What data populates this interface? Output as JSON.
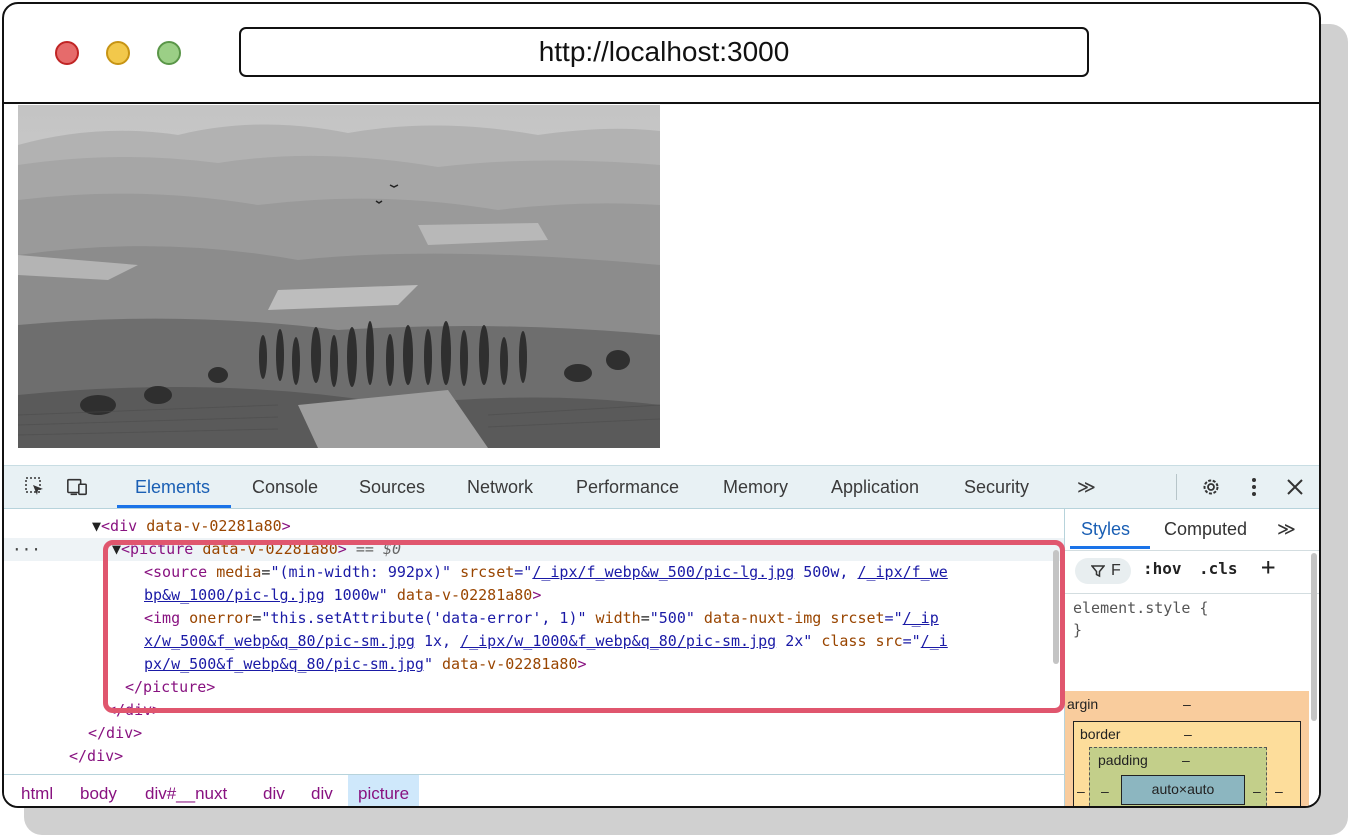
{
  "browser": {
    "url": "http://localhost:3000",
    "traffic_lights": {
      "close": "#e66b6b",
      "minimize": "#f2c84b",
      "maximize": "#9bcf86"
    }
  },
  "devtools": {
    "tabs": [
      "Elements",
      "Console",
      "Sources",
      "Network",
      "Performance",
      "Memory",
      "Application",
      "Security"
    ],
    "active_tab": "Elements",
    "more_tabs": "≫",
    "dom_lines": {
      "l0": {
        "open": "<div",
        "attr": "data-v-02281a80",
        "close": ">"
      },
      "l1": {
        "open": "<picture",
        "attr": "data-v-02281a80",
        "close": ">",
        "eq": "==",
        "ref": "$0"
      },
      "l2": {
        "open": "<source",
        "attr1": "media",
        "val1": "\"(min-width: 992px)\"",
        "attr2": "srcset",
        "q": "=\"",
        "link1": "/_ipx/f_webp&w_500/pic-lg.jpg",
        "mid1": " 500w, ",
        "link2a": "/_ipx/f_we"
      },
      "l3": {
        "link2b": "bp&w_1000/pic-lg.jpg",
        "tail": " 1000w\"",
        "attr": "data-v-02281a80",
        "close": ">"
      },
      "l4": {
        "open": "<img",
        "attr1": "onerror",
        "val1": "\"this.setAttribute('data-error', 1)\"",
        "attr2": "width",
        "val2": "\"500\"",
        "attr3": "data-nuxt-img",
        "attr4": "srcset",
        "q": "=\"",
        "link1a": "/_ip"
      },
      "l5": {
        "link1b": "x/w_500&f_webp&q_80/pic-sm.jpg",
        "mid": " 1x, ",
        "link2": "/_ipx/w_1000&f_webp&q_80/pic-sm.jpg",
        "tail": " 2x\"",
        "attr1": "class",
        "attr2": "src",
        "q": "=\"",
        "link3a": "/_i"
      },
      "l6": {
        "link3b": "px/w_500&f_webp&q_80/pic-sm.jpg",
        "q": "\"",
        "attr": "data-v-02281a80",
        "close": ">"
      },
      "l7": {
        "close": "</picture>"
      },
      "l8": {
        "close": "</div>"
      },
      "l9": {
        "close": "</div>"
      },
      "l10": {
        "close": "</div>"
      }
    },
    "breadcrumbs": [
      "html",
      "body",
      "div#__nuxt",
      "div",
      "div",
      "picture"
    ],
    "active_crumb": "picture",
    "styles_panel": {
      "tabs": [
        "Styles",
        "Computed"
      ],
      "more": "≫",
      "filter_placeholder": "F",
      "hov": ":hov",
      "cls": ".cls",
      "plus": "+",
      "element_style": "element.style {",
      "element_style_close": "}",
      "box_model": {
        "margin": "argin",
        "margin_value": "–",
        "border": "border",
        "border_value": "–",
        "padding": "padding",
        "padding_value": "–",
        "content": "auto×auto",
        "left": "–",
        "right": "–",
        "pad_left": "–",
        "pad_right": "–"
      }
    }
  }
}
